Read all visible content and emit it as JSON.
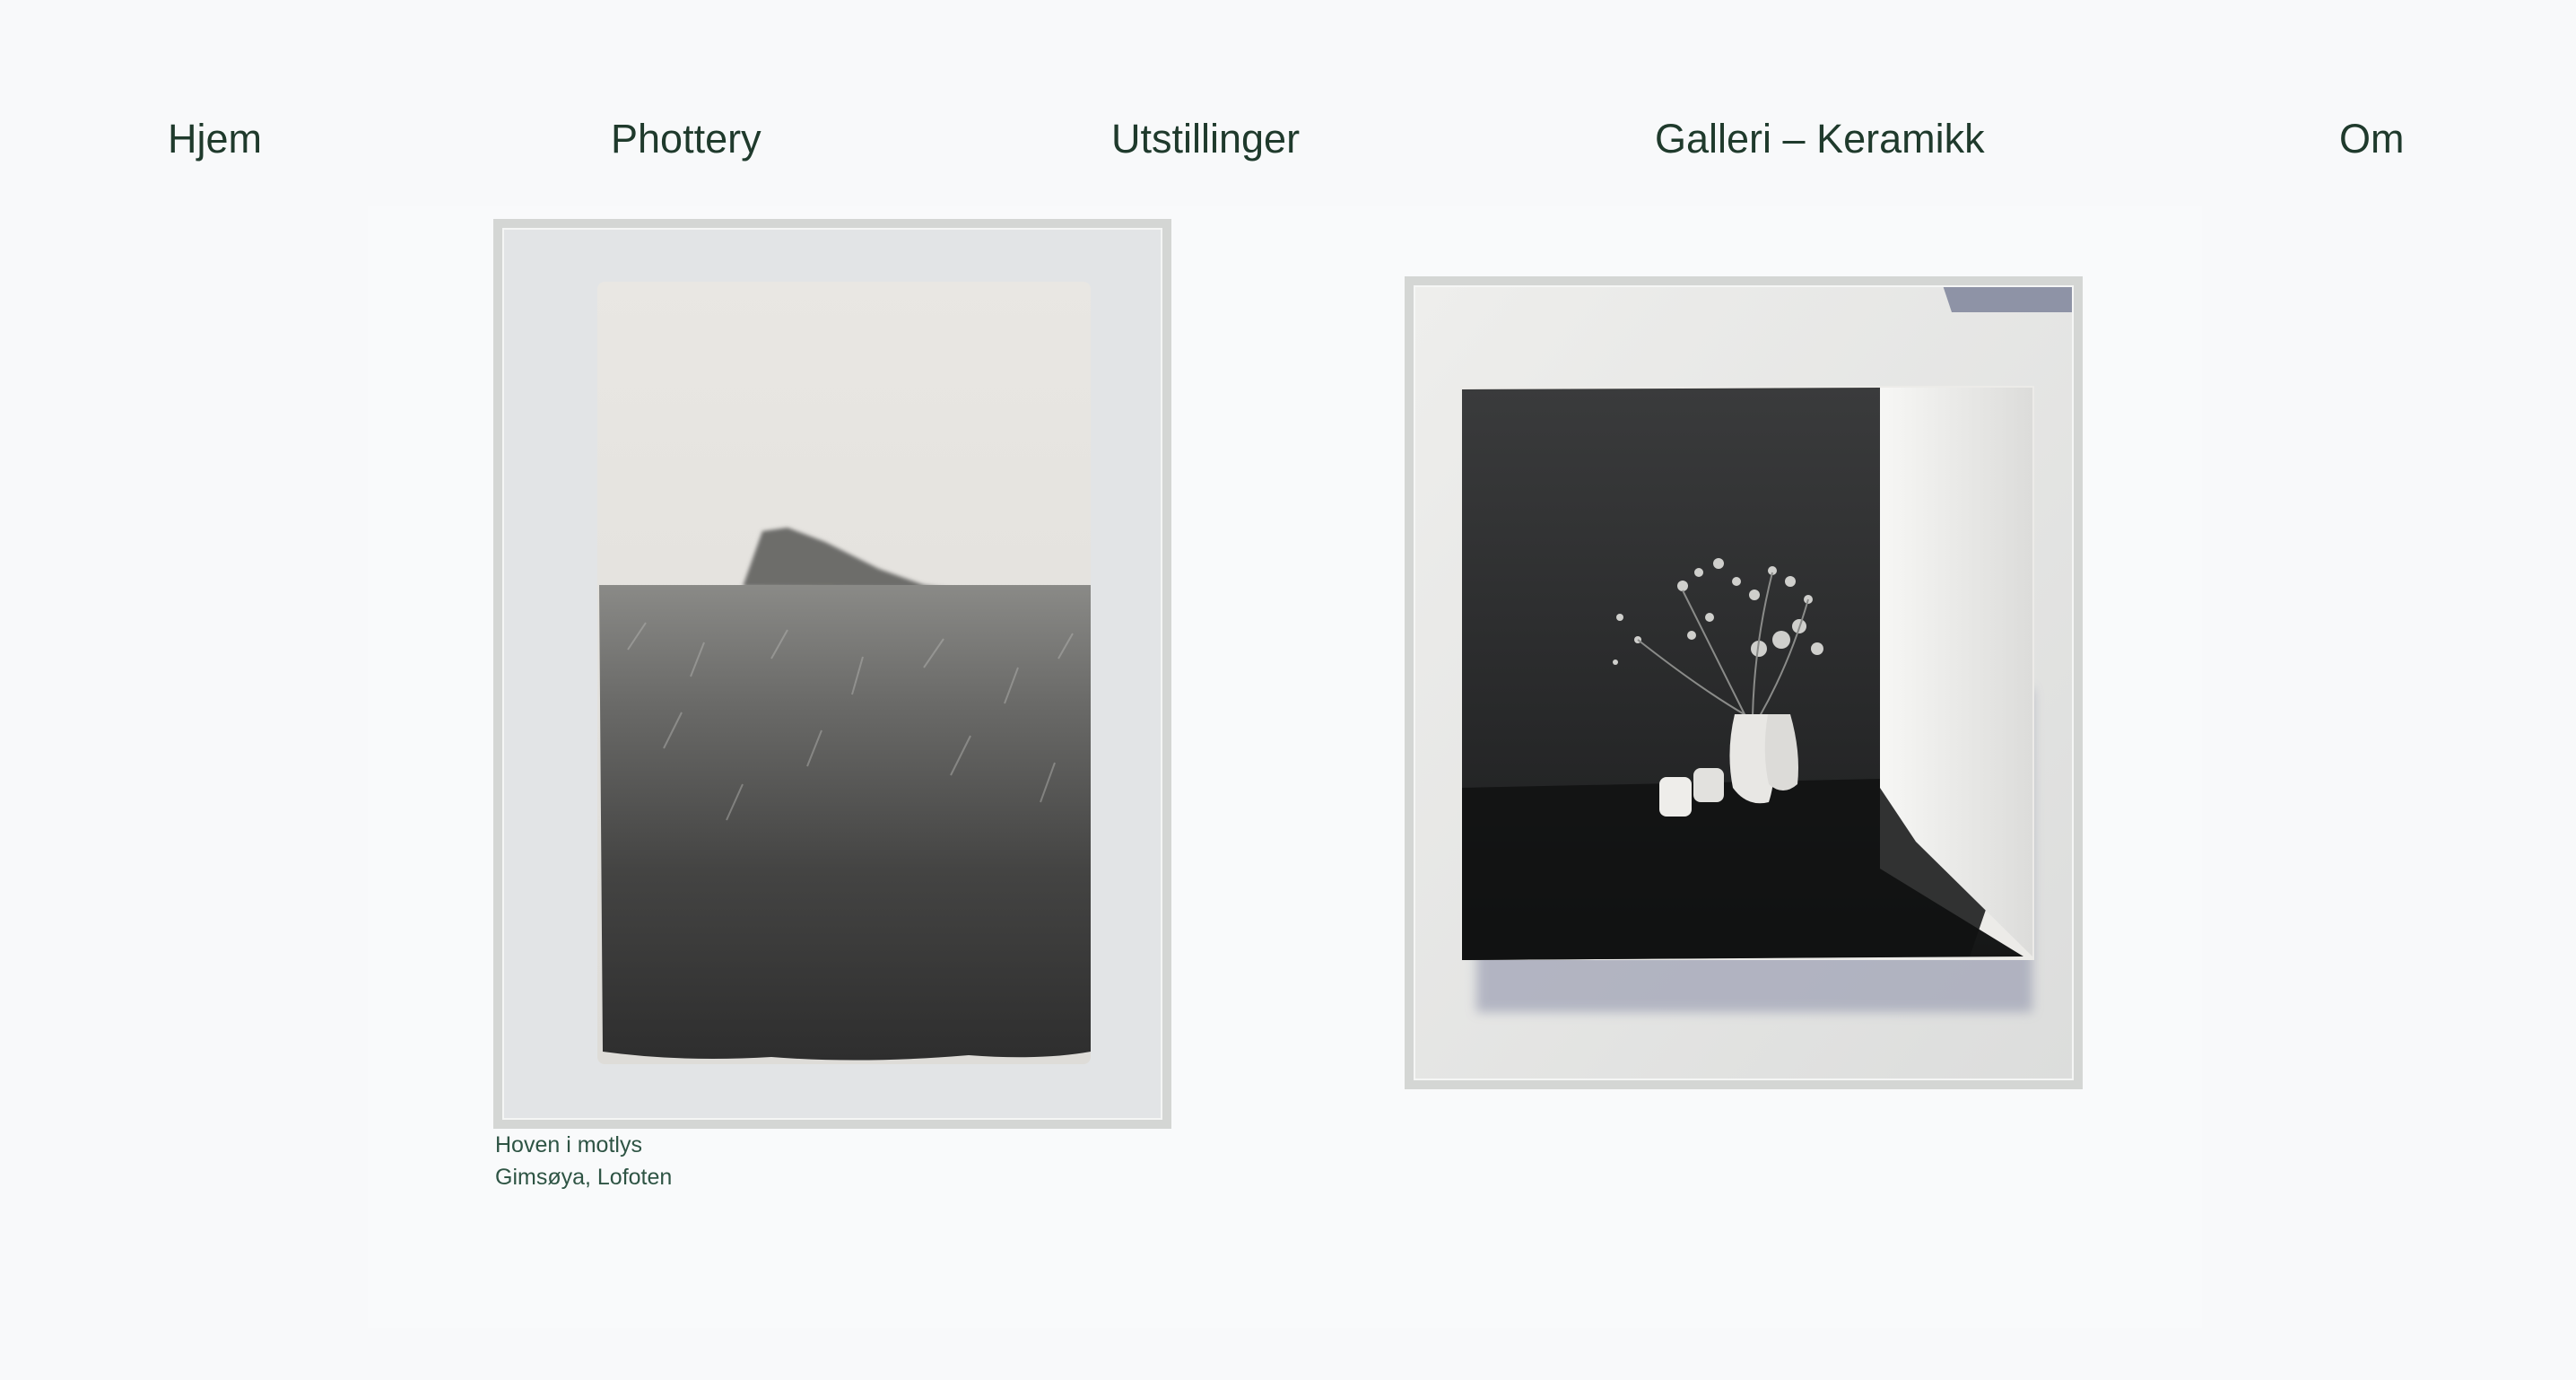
{
  "nav": {
    "items": [
      {
        "label": "Hjem"
      },
      {
        "label": "Phottery"
      },
      {
        "label": "Utstillinger"
      },
      {
        "label": "Galleri – Keramikk"
      },
      {
        "label": "Om"
      }
    ]
  },
  "gallery": {
    "items": [
      {
        "title": "Hoven i motlys",
        "location": "Gimsøya, Lofoten"
      },
      {
        "title": "",
        "location": ""
      }
    ]
  },
  "colors": {
    "text": "#1f3a2c",
    "caption": "#2e5444",
    "background": "#f8f9fa"
  }
}
